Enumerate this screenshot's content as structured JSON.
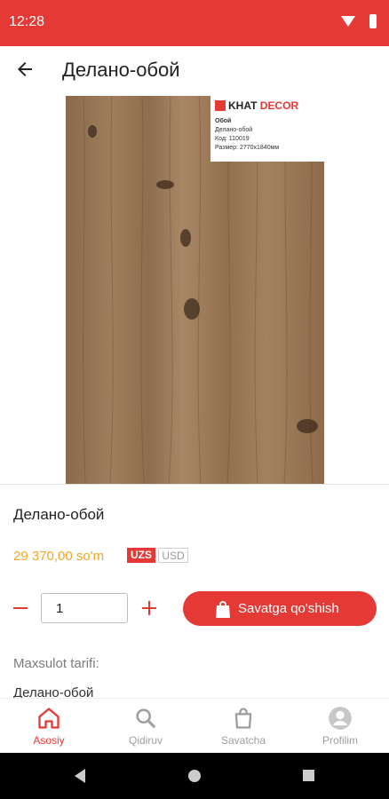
{
  "status_bar": {
    "time": "12:28"
  },
  "app_bar": {
    "title": "Делано-обой"
  },
  "product_image": {
    "brand_khat": "KHAT",
    "brand_decor": "DECOR",
    "label_type": "Обой",
    "label_name": "Делано-обой",
    "label_code": "Код: 110019",
    "label_size": "Размер: 2770x1840мм"
  },
  "product": {
    "name": "Делано-обой",
    "price": "29 370,00 so'm",
    "currency_active": "UZS",
    "currency_other": "USD",
    "quantity": "1",
    "add_to_cart": "Savatga qo'shish",
    "description_label": "Maxsulot tarifi:",
    "description": "Делано-обой"
  },
  "bottom_nav": {
    "items": [
      {
        "label": "Asosiy",
        "icon": "home-icon",
        "active": true
      },
      {
        "label": "Qidiruv",
        "icon": "search-icon",
        "active": false
      },
      {
        "label": "Savatcha",
        "icon": "shopping-bag-icon",
        "active": false
      },
      {
        "label": "Profilim",
        "icon": "account-icon",
        "active": false
      }
    ]
  },
  "colors": {
    "accent": "#e53935",
    "price": "#f5a623",
    "muted": "#9e9e9e"
  }
}
